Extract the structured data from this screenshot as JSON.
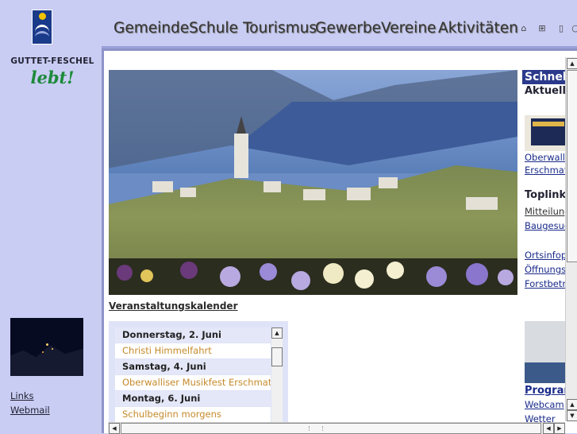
{
  "brand": {
    "name": "GUTTET-FESCHEL",
    "slogan": "lebt!"
  },
  "nav": {
    "items": [
      "Gemeinde",
      "Schule",
      "Tourismus",
      "Gewerbe",
      "Vereine",
      "Aktivitäten"
    ],
    "icons": [
      "home-icon",
      "sitemap-icon",
      "print-icon",
      "search-icon"
    ]
  },
  "left_links": [
    "Links",
    "Webmail"
  ],
  "main": {
    "events_link": "Veranstaltungskalender",
    "calendar": [
      {
        "type": "day",
        "text": "Donnerstag, 2. Juni"
      },
      {
        "type": "event",
        "text": "Christi Himmelfahrt"
      },
      {
        "type": "day",
        "text": "Samstag, 4. Juni"
      },
      {
        "type": "event",
        "text": "Oberwalliser Musikfest Erschmatt"
      },
      {
        "type": "day",
        "text": "Montag, 6. Juni"
      },
      {
        "type": "event",
        "text": "Schulbeginn morgens"
      }
    ]
  },
  "right": {
    "header": "Schnell",
    "aktuell": "Aktuell",
    "aktuell_links": [
      "Oberwalliser",
      "Erschmatt"
    ],
    "toplinks": "Toplinks",
    "toplinks_items": [
      "Mitteilungen",
      "Baugesuche"
    ],
    "more_links": [
      "Ortsinfopläne",
      "Öffnungszeiten",
      "Forstbetrieb"
    ],
    "programm": "Programm",
    "bottom_links": [
      "Webcam",
      "Wetter"
    ]
  },
  "colors": {
    "sidebar_bg": "#c9cdf3",
    "brand_green": "#1d8a3a",
    "event_orange": "#c58a2a",
    "header_blue": "#2b3a8c"
  }
}
